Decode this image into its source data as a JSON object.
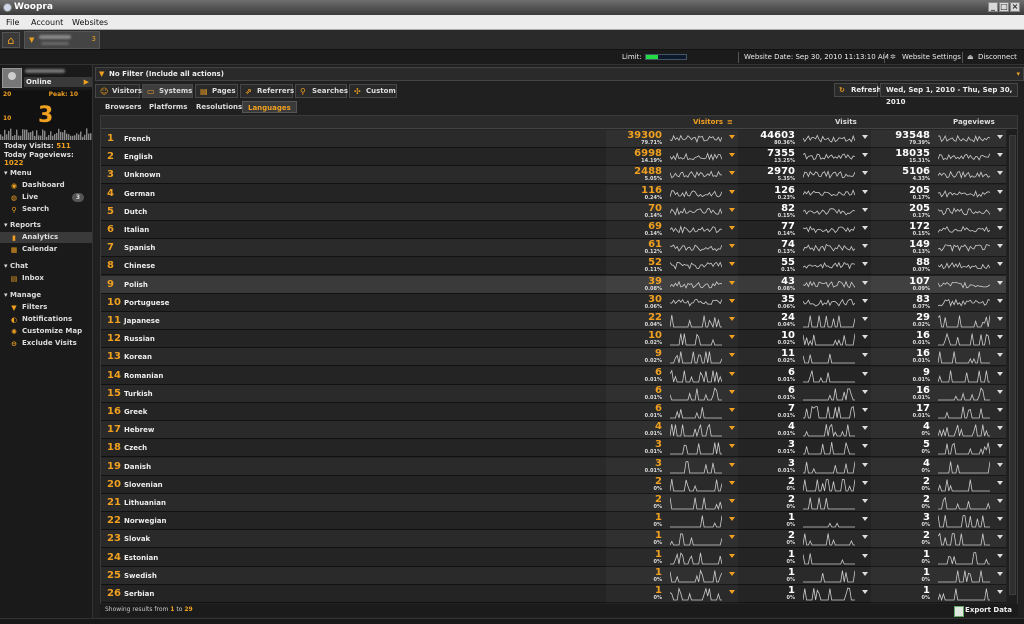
{
  "window": {
    "title": "Woopra"
  },
  "menu": [
    "File",
    "Account",
    "Websites"
  ],
  "site_tab": {
    "count": "3"
  },
  "status": {
    "limit_label": "Limit:",
    "limit_fraction": 0.3,
    "website_date": "Website Date: Sep 30, 2010 11:13:10 AM",
    "settings": "Website Settings",
    "disconnect": "Disconnect"
  },
  "user": {
    "status": "Online"
  },
  "live_graph": {
    "current": "3",
    "peak": "Peak: 10",
    "axis_top": "20",
    "axis_mid": "10"
  },
  "stats": {
    "visits_label": "Today Visits:",
    "visits": "511",
    "pageviews_label": "Today Pageviews:",
    "pageviews": "1022"
  },
  "sidebar": {
    "menu_title": "Menu",
    "dashboard": "Dashboard",
    "live": "Live",
    "live_badge": "3",
    "search": "Search",
    "reports_title": "Reports",
    "analytics": "Analytics",
    "calendar": "Calendar",
    "chat_title": "Chat",
    "inbox": "Inbox",
    "manage_title": "Manage",
    "filters": "Filters",
    "notifications": "Notifications",
    "customize_map": "Customize Map",
    "exclude_visits": "Exclude Visits"
  },
  "filter": {
    "label": "No Filter (Include all actions)"
  },
  "tabs": {
    "visitors": "Visitors",
    "systems": "Systems",
    "pages": "Pages",
    "referrers": "Referrers",
    "searches": "Searches",
    "custom": "Custom"
  },
  "refresh": "Refresh",
  "date_range": "Wed, Sep 1, 2010 - Thu, Sep 30, 2010",
  "subtabs": {
    "browsers": "Browsers",
    "platforms": "Platforms",
    "resolutions": "Resolutions",
    "languages": "Languages"
  },
  "columns": {
    "visitors": "Visitors",
    "visits": "Visits",
    "pageviews": "Pageviews"
  },
  "rows": [
    {
      "n": "1",
      "lang": "French",
      "visitors": "39300",
      "vp": "79.71%",
      "visits": "44603",
      "sp": "80.36%",
      "pageviews": "93548",
      "pp": "79.39%"
    },
    {
      "n": "2",
      "lang": "English",
      "visitors": "6998",
      "vp": "14.19%",
      "visits": "7355",
      "sp": "13.25%",
      "pageviews": "18035",
      "pp": "15.31%"
    },
    {
      "n": "3",
      "lang": "Unknown",
      "visitors": "2488",
      "vp": "5.05%",
      "visits": "2970",
      "sp": "5.35%",
      "pageviews": "5106",
      "pp": "4.33%"
    },
    {
      "n": "4",
      "lang": "German",
      "visitors": "116",
      "vp": "0.24%",
      "visits": "126",
      "sp": "0.23%",
      "pageviews": "205",
      "pp": "0.17%"
    },
    {
      "n": "5",
      "lang": "Dutch",
      "visitors": "70",
      "vp": "0.14%",
      "visits": "82",
      "sp": "0.15%",
      "pageviews": "205",
      "pp": "0.17%"
    },
    {
      "n": "6",
      "lang": "Italian",
      "visitors": "69",
      "vp": "0.14%",
      "visits": "77",
      "sp": "0.14%",
      "pageviews": "172",
      "pp": "0.15%"
    },
    {
      "n": "7",
      "lang": "Spanish",
      "visitors": "61",
      "vp": "0.12%",
      "visits": "74",
      "sp": "0.13%",
      "pageviews": "149",
      "pp": "0.13%"
    },
    {
      "n": "8",
      "lang": "Chinese",
      "visitors": "52",
      "vp": "0.11%",
      "visits": "55",
      "sp": "0.1%",
      "pageviews": "88",
      "pp": "0.07%"
    },
    {
      "n": "9",
      "lang": "Polish",
      "visitors": "39",
      "vp": "0.08%",
      "visits": "43",
      "sp": "0.08%",
      "pageviews": "107",
      "pp": "0.09%"
    },
    {
      "n": "10",
      "lang": "Portuguese",
      "visitors": "30",
      "vp": "0.06%",
      "visits": "35",
      "sp": "0.06%",
      "pageviews": "83",
      "pp": "0.07%"
    },
    {
      "n": "11",
      "lang": "Japanese",
      "visitors": "22",
      "vp": "0.04%",
      "visits": "24",
      "sp": "0.04%",
      "pageviews": "29",
      "pp": "0.02%"
    },
    {
      "n": "12",
      "lang": "Russian",
      "visitors": "10",
      "vp": "0.02%",
      "visits": "10",
      "sp": "0.02%",
      "pageviews": "16",
      "pp": "0.01%"
    },
    {
      "n": "13",
      "lang": "Korean",
      "visitors": "9",
      "vp": "0.02%",
      "visits": "11",
      "sp": "0.02%",
      "pageviews": "16",
      "pp": "0.01%"
    },
    {
      "n": "14",
      "lang": "Romanian",
      "visitors": "6",
      "vp": "0.01%",
      "visits": "6",
      "sp": "0.01%",
      "pageviews": "9",
      "pp": "0.01%"
    },
    {
      "n": "15",
      "lang": "Turkish",
      "visitors": "6",
      "vp": "0.01%",
      "visits": "6",
      "sp": "0.01%",
      "pageviews": "16",
      "pp": "0.01%"
    },
    {
      "n": "16",
      "lang": "Greek",
      "visitors": "6",
      "vp": "0.01%",
      "visits": "7",
      "sp": "0.01%",
      "pageviews": "17",
      "pp": "0.01%"
    },
    {
      "n": "17",
      "lang": "Hebrew",
      "visitors": "4",
      "vp": "0.01%",
      "visits": "4",
      "sp": "0.01%",
      "pageviews": "4",
      "pp": "0%"
    },
    {
      "n": "18",
      "lang": "Czech",
      "visitors": "3",
      "vp": "0.01%",
      "visits": "3",
      "sp": "0.01%",
      "pageviews": "5",
      "pp": "0%"
    },
    {
      "n": "19",
      "lang": "Danish",
      "visitors": "3",
      "vp": "0.01%",
      "visits": "3",
      "sp": "0.01%",
      "pageviews": "4",
      "pp": "0%"
    },
    {
      "n": "20",
      "lang": "Slovenian",
      "visitors": "2",
      "vp": "0%",
      "visits": "2",
      "sp": "0%",
      "pageviews": "2",
      "pp": "0%"
    },
    {
      "n": "21",
      "lang": "Lithuanian",
      "visitors": "2",
      "vp": "0%",
      "visits": "2",
      "sp": "0%",
      "pageviews": "2",
      "pp": "0%"
    },
    {
      "n": "22",
      "lang": "Norwegian",
      "visitors": "1",
      "vp": "0%",
      "visits": "1",
      "sp": "0%",
      "pageviews": "3",
      "pp": "0%"
    },
    {
      "n": "23",
      "lang": "Slovak",
      "visitors": "1",
      "vp": "0%",
      "visits": "2",
      "sp": "0%",
      "pageviews": "2",
      "pp": "0%"
    },
    {
      "n": "24",
      "lang": "Estonian",
      "visitors": "1",
      "vp": "0%",
      "visits": "1",
      "sp": "0%",
      "pageviews": "1",
      "pp": "0%"
    },
    {
      "n": "25",
      "lang": "Swedish",
      "visitors": "1",
      "vp": "0%",
      "visits": "1",
      "sp": "0%",
      "pageviews": "1",
      "pp": "0%"
    },
    {
      "n": "26",
      "lang": "Serbian",
      "visitors": "1",
      "vp": "0%",
      "visits": "1",
      "sp": "0%",
      "pageviews": "1",
      "pp": "0%"
    }
  ],
  "footer": {
    "prefix": "Showing results from",
    "from": "1",
    "mid": "to",
    "to": "29",
    "export": "Export Data"
  },
  "colors": {
    "accent": "#f0a020",
    "background": "#202020"
  }
}
